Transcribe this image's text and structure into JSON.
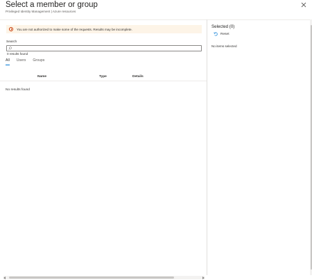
{
  "header": {
    "title": "Select a member or group",
    "subtitle": "Privileged Identity Management | Azure resources",
    "close_icon": "close-icon"
  },
  "alert": {
    "icon": "warning-circle-icon",
    "text": "You are not authorized to make some of the requests. Results may be incomplete.",
    "color": "#fdf4e7"
  },
  "search": {
    "label": "Search",
    "value": "",
    "placeholder": "",
    "icon": "search-icon",
    "results_count": "0 results found"
  },
  "tabs": [
    {
      "label": "All",
      "active": true
    },
    {
      "label": "Users",
      "active": false
    },
    {
      "label": "Groups",
      "active": false
    }
  ],
  "table": {
    "columns": [
      "Name",
      "Type",
      "Details"
    ],
    "empty_message": "No results found"
  },
  "selected": {
    "title": "Selected (0)",
    "reset_label": "Reset",
    "reset_icon": "reset-icon",
    "empty_message": "No items selected"
  },
  "colors": {
    "accent": "#0078d4",
    "warning": "#c43501"
  }
}
